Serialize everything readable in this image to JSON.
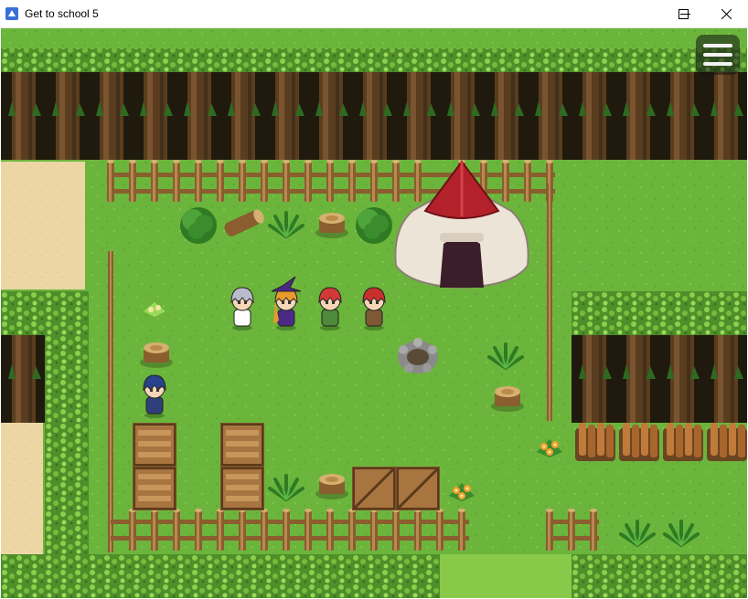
{
  "window": {
    "title": "Get to school 5",
    "controls": [
      "minimize-icon",
      "maximize-icon",
      "close-icon"
    ]
  },
  "game": {
    "menu_button_icon": "hamburger-menu-icon",
    "colors": {
      "grass": "#6cb53c",
      "path": "#88c94a",
      "sand": "#ecd7a4",
      "hedge": "#4e8f2a",
      "forest_dark": "#1f1a0d",
      "trunk": "#6a4a26",
      "fence": "#a57a44",
      "tent_red": "#b3222a",
      "tent_cloth": "#ece4d6"
    },
    "characters": [
      {
        "name": "silver-haired-mage",
        "hair": "#b9bccc",
        "outfit": "#ffffff"
      },
      {
        "name": "witch",
        "hair": "#e89a2a",
        "outfit": "#4a2a86"
      },
      {
        "name": "red-haired-boy",
        "hair": "#d13a36",
        "outfit": "#4f8a3a"
      },
      {
        "name": "red-haired-warrior",
        "hair": "#c8302e",
        "outfit": "#7f5836"
      },
      {
        "name": "blue-haired-student",
        "hair": "#28438c",
        "outfit": "#2e3f7a"
      }
    ]
  }
}
